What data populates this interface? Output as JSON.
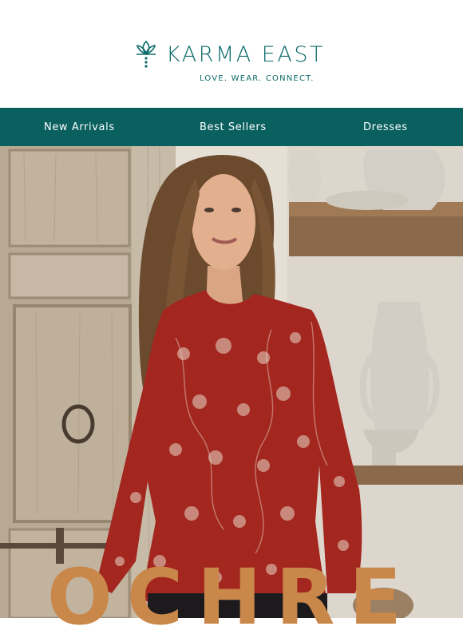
{
  "brand": {
    "name": "KARMA EAST",
    "tagline": "LOVE. WEAR. CONNECT.",
    "color": "#0f6b6b"
  },
  "nav": {
    "background": "#0a5f5f",
    "items": [
      {
        "label": "New Arrivals"
      },
      {
        "label": "Best Sellers"
      },
      {
        "label": "Dresses"
      }
    ]
  },
  "hero": {
    "headline": "OCHRE",
    "headline_color": "#c9874a",
    "top_color": "#a3261f"
  }
}
